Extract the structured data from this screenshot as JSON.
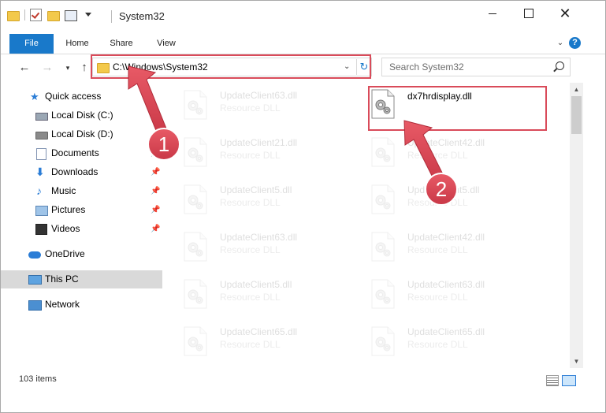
{
  "window": {
    "title": "System32",
    "colors": {
      "accent": "#1979ca",
      "highlight": "#d94b5a"
    }
  },
  "ribbon": {
    "tabs": [
      "File",
      "Home",
      "Share",
      "View"
    ],
    "help": "?"
  },
  "nav": {
    "address": "C:\\Windows\\System32",
    "search_placeholder": "Search System32"
  },
  "sidebar": {
    "items": [
      {
        "label": "Quick access",
        "icon": "star-icon"
      },
      {
        "label": "Local Disk (C:)",
        "icon": "drive-icon"
      },
      {
        "label": "Local Disk (D:)",
        "icon": "drive-icon"
      },
      {
        "label": "Documents",
        "icon": "documents-icon",
        "pinned": true
      },
      {
        "label": "Downloads",
        "icon": "download-icon",
        "pinned": true
      },
      {
        "label": "Music",
        "icon": "music-icon",
        "pinned": true
      },
      {
        "label": "Pictures",
        "icon": "pictures-icon",
        "pinned": true
      },
      {
        "label": "Videos",
        "icon": "video-icon",
        "pinned": true
      },
      {
        "label": "OneDrive",
        "icon": "cloud-icon"
      },
      {
        "label": "This PC",
        "icon": "computer-icon",
        "selected": true
      },
      {
        "label": "Network",
        "icon": "network-icon"
      }
    ]
  },
  "files": {
    "highlighted": {
      "name": "dx7hrdisplay.dll"
    },
    "left": [
      {
        "name": "UpdateClient63.dll",
        "type": "Resource DLL"
      },
      {
        "name": "UpdateClient21.dll",
        "type": "Resource DLL"
      },
      {
        "name": "UpdateClient5.dll",
        "type": "Resource DLL"
      },
      {
        "name": "UpdateClient63.dll",
        "type": "Resource DLL"
      },
      {
        "name": "UpdateClient5.dll",
        "type": "Resource DLL"
      },
      {
        "name": "UpdateClient65.dll",
        "type": "Resource DLL"
      }
    ],
    "right": [
      {
        "name": "UpdateClient42.dll",
        "type": "Resource DLL"
      },
      {
        "name": "UpdateClient5.dll",
        "type": "Resource DLL"
      },
      {
        "name": "UpdateClient42.dll",
        "type": "Resource DLL"
      },
      {
        "name": "UpdateClient63.dll",
        "type": "Resource DLL"
      },
      {
        "name": "UpdateClient65.dll",
        "type": "Resource DLL"
      }
    ]
  },
  "status": {
    "items": "103 items"
  },
  "annotations": {
    "step1": "1",
    "step2": "2"
  }
}
